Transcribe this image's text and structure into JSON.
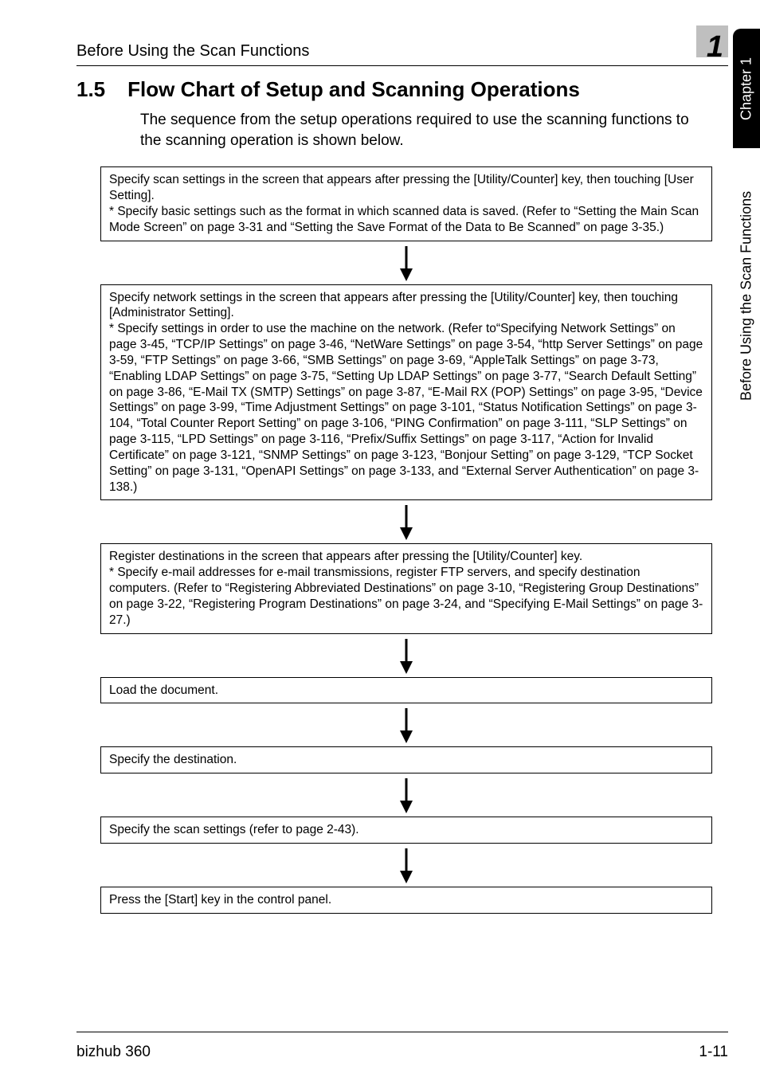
{
  "header": {
    "running_head": "Before Using the Scan Functions",
    "chapter_digit": "1"
  },
  "side_tab": {
    "black": "Chapter 1",
    "white": "Before Using the Scan Functions"
  },
  "section": {
    "number": "1.5",
    "title": "Flow Chart of Setup and Scanning Operations",
    "intro": "The sequence from the setup operations required to use the scanning functions to the scanning operation is shown below."
  },
  "steps": [
    "Specify scan settings in the screen that appears after pressing the [Utility/Counter] key, then touching [User Setting].\n* Specify basic settings such as the format in which scanned data is saved. (Refer to “Setting the Main Scan Mode Screen” on page 3-31 and “Setting the Save Format of the Data to Be Scanned” on page 3-35.)",
    "Specify network settings in the screen that appears after pressing the [Utility/Counter] key, then touching [Administrator Setting].\n* Specify settings in order to use the machine on the network. (Refer to“Specifying Network Settings” on page 3-45, “TCP/IP Settings” on page 3-46, “NetWare Settings” on page 3-54, “http Server Settings” on page 3-59, “FTP Settings” on page 3-66, “SMB Settings” on page 3-69, “AppleTalk Settings” on page 3-73, “Enabling LDAP Settings” on page 3-75, “Setting Up LDAP Settings” on page 3-77, “Search Default Setting” on page 3-86, “E-Mail TX (SMTP) Settings” on page 3-87, “E-Mail RX (POP) Settings” on page 3-95, “Device Settings” on page 3-99, “Time Adjustment Settings” on page 3-101, “Status Notification Settings” on page 3-104, “Total Counter Report Setting” on page 3-106, “PING Confirmation” on page 3-111, “SLP Settings” on page 3-115, “LPD Settings” on page 3-116, “Prefix/Suffix Settings” on page 3-117, “Action for Invalid Certificate” on page 3-121, “SNMP Settings” on page 3-123, “Bonjour Setting” on page 3-129, “TCP Socket Setting” on page 3-131, “OpenAPI Settings” on page 3-133, and “External Server Authentication” on page 3-138.)",
    "Register destinations in the screen that appears after pressing the [Utility/Counter] key.\n* Specify e-mail addresses for e-mail transmissions, register FTP servers, and specify destination computers. (Refer to “Registering Abbreviated Destinations” on page 3-10, “Registering Group Destinations” on page 3-22, “Registering Program Destinations” on page 3-24, and “Specifying E-Mail Settings” on page 3-27.)",
    "Load the document.",
    "Specify the destination.",
    "Specify the scan settings (refer to page 2-43).",
    "Press the [Start] key in the control panel."
  ],
  "footer": {
    "left": "bizhub 360",
    "right": "1-11"
  }
}
